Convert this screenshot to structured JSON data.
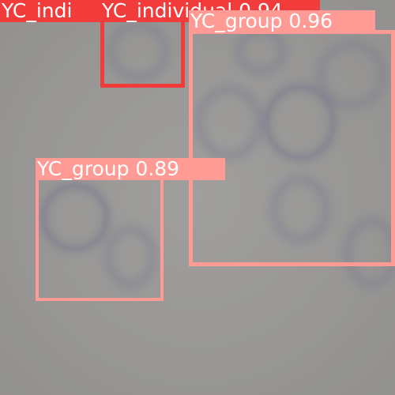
{
  "image": {
    "description_icon": "microscope-field-image"
  },
  "detections": [
    {
      "label": "YC_indi",
      "color": "#f23b3b"
    },
    {
      "label": "YC_individual 0.94",
      "color": "#f23b3b"
    },
    {
      "label": "YC_group 0.96",
      "color": "#ff9a95"
    },
    {
      "label": "YC_group 0.89",
      "color": "#ff9a95"
    }
  ]
}
